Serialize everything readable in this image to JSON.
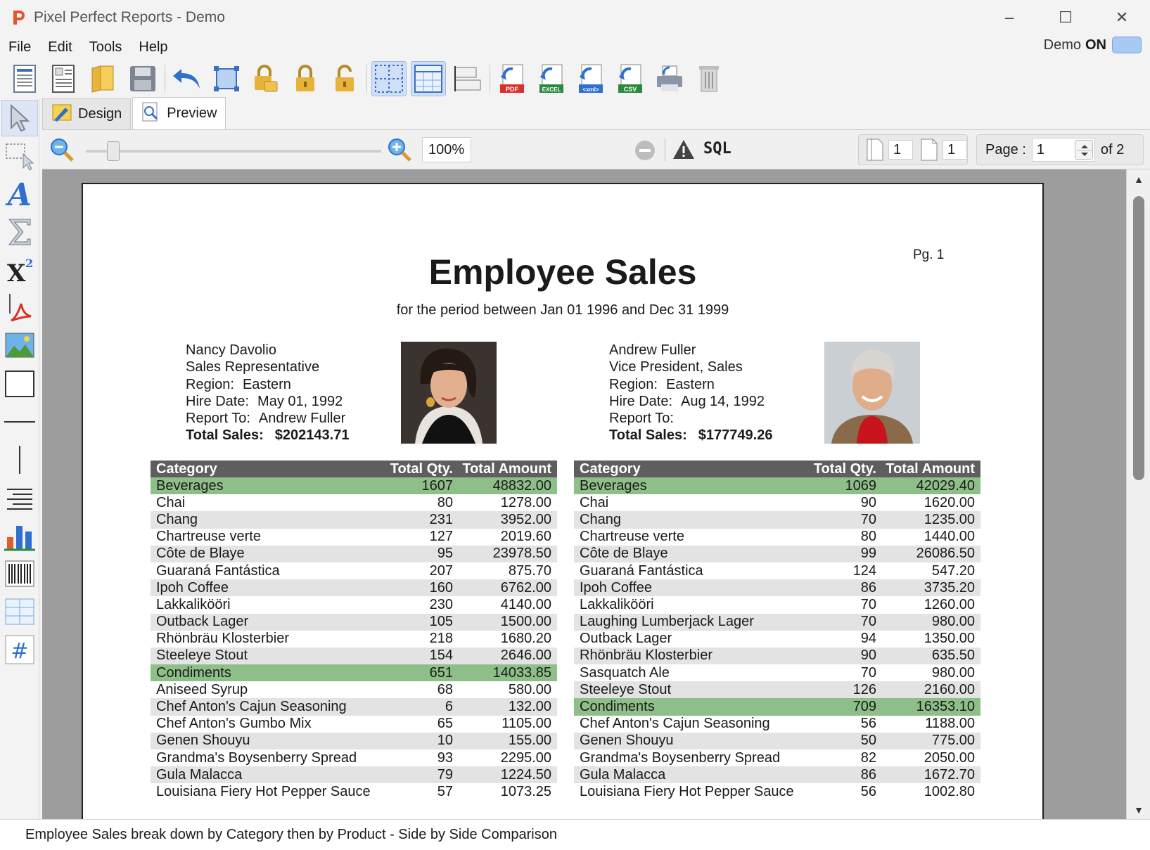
{
  "window": {
    "title": "Pixel Perfect Reports - Demo",
    "controls": [
      "–",
      "☐",
      "✕"
    ]
  },
  "menu": {
    "items": [
      "File",
      "Edit",
      "Tools",
      "Help"
    ],
    "demo_label": "Demo",
    "demo_state": "ON"
  },
  "toolbar": {
    "buttons": [
      "new-report-icon",
      "report-wizard-icon",
      "open-folder-icon",
      "save-icon",
      "undo-icon",
      "select-all-icon",
      "lock-icon",
      "lock-closed-icon",
      "unlock-icon",
      "grid-icon",
      "snap-grid-icon",
      "align-icon",
      "export-pdf-icon",
      "export-excel-icon",
      "export-xml-icon",
      "export-csv-icon",
      "print-icon",
      "delete-icon"
    ],
    "export_labels": {
      "pdf": "PDF",
      "excel": "EXCEL",
      "xml": "<xml>",
      "csv": "CSV"
    }
  },
  "tabs": [
    {
      "label": "Design",
      "selected": false
    },
    {
      "label": "Preview",
      "selected": true
    }
  ],
  "preview_toolbar": {
    "zoom": "100%",
    "sql_label": "SQL",
    "pages_across": "1",
    "pages_down": "1",
    "page_label": "Page :",
    "page_value": "1",
    "of_label": "of 2"
  },
  "report": {
    "page_number": "Pg. 1",
    "title": "Employee Sales",
    "subtitle": "for the period between Jan 01 1996 and Dec 31 1999",
    "columns": {
      "category": "Category",
      "qty": "Total Qty.",
      "amount": "Total Amount"
    },
    "employees": [
      {
        "name": "Nancy Davolio",
        "job_title": "Sales Representative",
        "region_label": "Region:",
        "region": "Eastern",
        "hire_label": "Hire Date:",
        "hire_date": "May 01, 1992",
        "report_label": "Report To:",
        "report_to": "Andrew Fuller",
        "total_label": "Total Sales:",
        "total_sales": "$202143.71",
        "rows": [
          {
            "cat": "Beverages",
            "qty": "1607",
            "amt": "48832.00",
            "group": true
          },
          {
            "cat": "Chai",
            "qty": "80",
            "amt": "1278.00"
          },
          {
            "cat": "Chang",
            "qty": "231",
            "amt": "3952.00"
          },
          {
            "cat": "Chartreuse verte",
            "qty": "127",
            "amt": "2019.60"
          },
          {
            "cat": "Côte de Blaye",
            "qty": "95",
            "amt": "23978.50"
          },
          {
            "cat": "Guaraná Fantástica",
            "qty": "207",
            "amt": "875.70"
          },
          {
            "cat": "Ipoh Coffee",
            "qty": "160",
            "amt": "6762.00"
          },
          {
            "cat": "Lakkalikööri",
            "qty": "230",
            "amt": "4140.00"
          },
          {
            "cat": "Outback Lager",
            "qty": "105",
            "amt": "1500.00"
          },
          {
            "cat": "Rhönbräu Klosterbier",
            "qty": "218",
            "amt": "1680.20"
          },
          {
            "cat": "Steeleye Stout",
            "qty": "154",
            "amt": "2646.00"
          },
          {
            "cat": "Condiments",
            "qty": "651",
            "amt": "14033.85",
            "group": true
          },
          {
            "cat": "Aniseed Syrup",
            "qty": "68",
            "amt": "580.00"
          },
          {
            "cat": "Chef Anton's Cajun Seasoning",
            "qty": "6",
            "amt": "132.00"
          },
          {
            "cat": "Chef Anton's Gumbo Mix",
            "qty": "65",
            "amt": "1105.00"
          },
          {
            "cat": "Genen Shouyu",
            "qty": "10",
            "amt": "155.00"
          },
          {
            "cat": "Grandma's Boysenberry Spread",
            "qty": "93",
            "amt": "2295.00"
          },
          {
            "cat": "Gula Malacca",
            "qty": "79",
            "amt": "1224.50"
          },
          {
            "cat": "Louisiana Fiery Hot Pepper Sauce",
            "qty": "57",
            "amt": "1073.25"
          }
        ]
      },
      {
        "name": "Andrew Fuller",
        "job_title": "Vice President, Sales",
        "region_label": "Region:",
        "region": "Eastern",
        "hire_label": "Hire Date:",
        "hire_date": "Aug 14, 1992",
        "report_label": "Report To:",
        "report_to": "",
        "total_label": "Total Sales:",
        "total_sales": "$177749.26",
        "rows": [
          {
            "cat": "Beverages",
            "qty": "1069",
            "amt": "42029.40",
            "group": true
          },
          {
            "cat": "Chai",
            "qty": "90",
            "amt": "1620.00"
          },
          {
            "cat": "Chang",
            "qty": "70",
            "amt": "1235.00"
          },
          {
            "cat": "Chartreuse verte",
            "qty": "80",
            "amt": "1440.00"
          },
          {
            "cat": "Côte de Blaye",
            "qty": "99",
            "amt": "26086.50"
          },
          {
            "cat": "Guaraná Fantástica",
            "qty": "124",
            "amt": "547.20"
          },
          {
            "cat": "Ipoh Coffee",
            "qty": "86",
            "amt": "3735.20"
          },
          {
            "cat": "Lakkalikööri",
            "qty": "70",
            "amt": "1260.00"
          },
          {
            "cat": "Laughing Lumberjack Lager",
            "qty": "70",
            "amt": "980.00"
          },
          {
            "cat": "Outback Lager",
            "qty": "94",
            "amt": "1350.00"
          },
          {
            "cat": "Rhönbräu Klosterbier",
            "qty": "90",
            "amt": "635.50"
          },
          {
            "cat": "Sasquatch Ale",
            "qty": "70",
            "amt": "980.00"
          },
          {
            "cat": "Steeleye Stout",
            "qty": "126",
            "amt": "2160.00"
          },
          {
            "cat": "Condiments",
            "qty": "709",
            "amt": "16353.10",
            "group": true
          },
          {
            "cat": "Chef Anton's Cajun Seasoning",
            "qty": "56",
            "amt": "1188.00"
          },
          {
            "cat": "Genen Shouyu",
            "qty": "50",
            "amt": "775.00"
          },
          {
            "cat": "Grandma's Boysenberry Spread",
            "qty": "82",
            "amt": "2050.00"
          },
          {
            "cat": "Gula Malacca",
            "qty": "86",
            "amt": "1672.70"
          },
          {
            "cat": "Louisiana Fiery Hot Pepper Sauce",
            "qty": "56",
            "amt": "1002.80"
          }
        ]
      }
    ]
  },
  "status": {
    "text": "Employee Sales break down by Category then by Product - Side by Side Comparison"
  },
  "colors": {
    "group_row": "#8fbf88",
    "header_row": "#5e5e5e",
    "alt_row": "#e3e3e3",
    "toggle_on": "#a9c9f5"
  }
}
